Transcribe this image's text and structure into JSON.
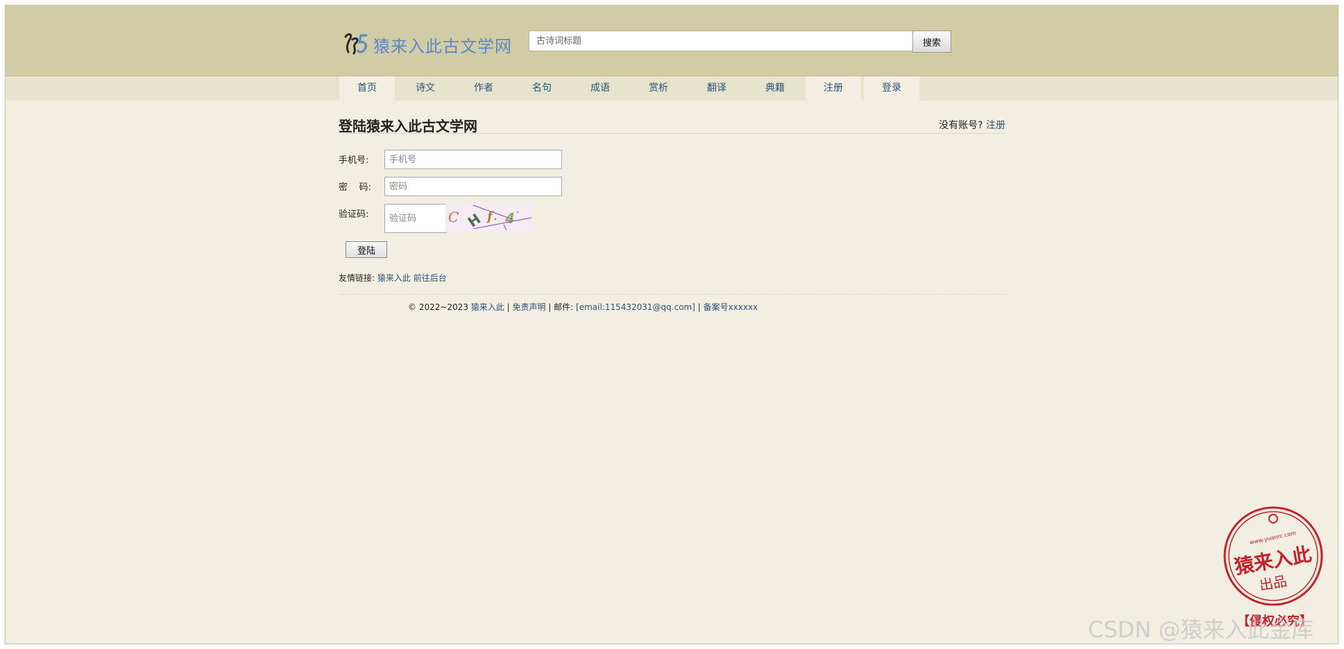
{
  "site": {
    "logo_text": "猿来入此古文学网"
  },
  "search": {
    "placeholder": "古诗词标题",
    "button_label": "搜索"
  },
  "nav": {
    "items": [
      "首页",
      "诗文",
      "作者",
      "名句",
      "成语",
      "赏析",
      "翻译",
      "典籍",
      "注册",
      "登录"
    ]
  },
  "login": {
    "title": "登陆猿来入此古文学网",
    "no_account": "没有账号?",
    "register_link": "注册",
    "phone_label": "手机号:",
    "phone_placeholder": "手机号",
    "password_label": "密    码:",
    "password_placeholder": "密码",
    "captcha_label": "验证码:",
    "captcha_placeholder": "验证码",
    "captcha_text": "C H f 4",
    "submit_label": "登陆"
  },
  "friend_links": {
    "label": "友情链接:",
    "items": [
      "猿来入此",
      "前往后台"
    ]
  },
  "footer": {
    "copyright": "© 2022~2023",
    "site_link": "猿来入此",
    "sep1": " | ",
    "disclaimer": "免责声明",
    "mail_label": " | 邮件: ",
    "email": "[email:115432031@qq.com]",
    "sep2": " | ",
    "icp": "备案号xxxxxx"
  },
  "stamp": {
    "center_text": "猿来入此",
    "sub_text": "出品",
    "url_text": "www.yuanrc.com",
    "banner_text": "【侵权必究】"
  },
  "watermark": "CSDN @猿来入此金库",
  "colors": {
    "header_bg": "#d1cca6",
    "page_bg": "#f2efe2",
    "link": "#2d5276",
    "logo": "#5b87c6",
    "stamp": "#c8202a"
  }
}
